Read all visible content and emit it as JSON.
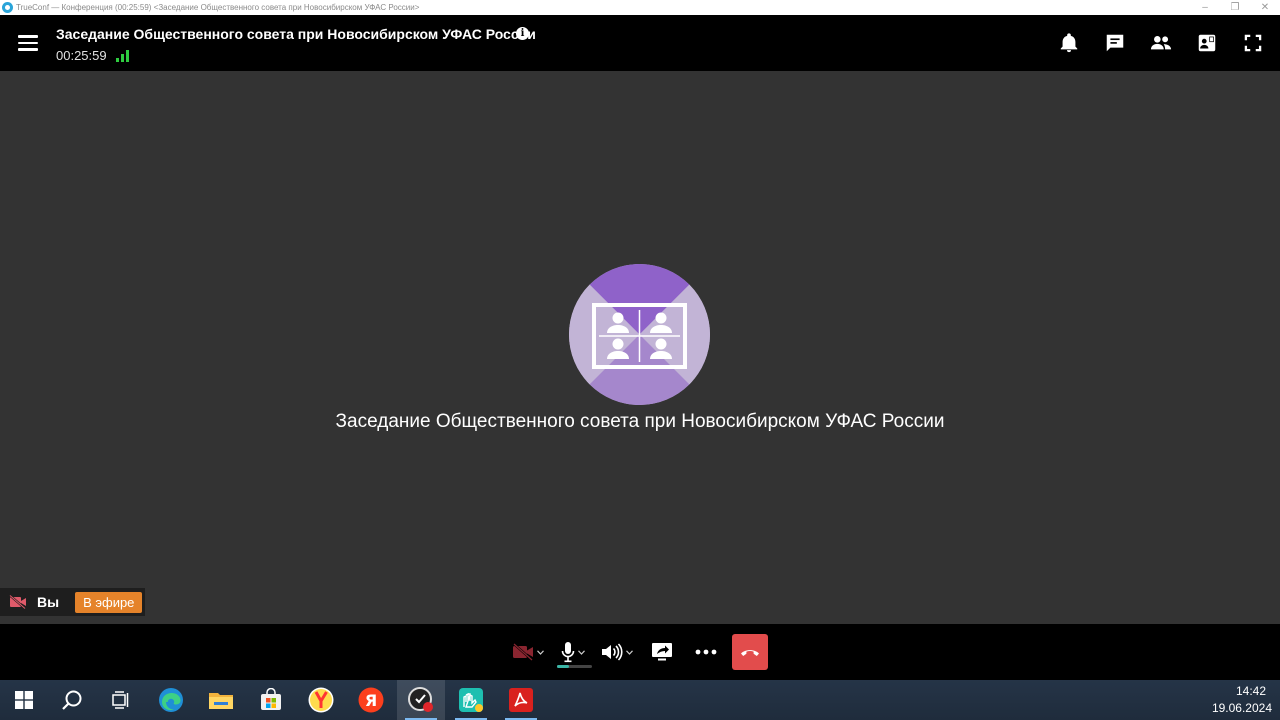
{
  "os_window": {
    "title": "TrueConf — Конференция (00:25:59) <Заседание Общественного совета при Новосибирском УФАС России>",
    "controls": [
      "–",
      "❐",
      "✕"
    ]
  },
  "header": {
    "conference_title": "Заседание Общественного совета при Новосибирском УФАС России",
    "timer": "00:25:59",
    "icons": [
      "menu-icon",
      "info-icon",
      "signal-strength-icon",
      "bell-icon",
      "chat-icon",
      "participants-icon",
      "layout-icon",
      "fullscreen-icon"
    ]
  },
  "stage": {
    "conference_name": "Заседание Общественного совета при Новосибирском УФАС России",
    "avatar_colors": {
      "top": "#8f62c9",
      "side": "#c2b4d6",
      "bottom": "#a587cc"
    }
  },
  "self_badge": {
    "label": "Вы",
    "status": "В эфире",
    "status_color": "#e5832a"
  },
  "controls": {
    "icons": [
      "camera-off-icon",
      "microphone-icon",
      "speaker-icon",
      "share-screen-icon",
      "more-icon",
      "hangup-icon"
    ],
    "mic_level": 0.35,
    "hangup_color": "#e24c4c"
  },
  "taskbar": {
    "apps": [
      "windows-start-icon",
      "search-icon",
      "task-view-icon",
      "edge-icon",
      "file-explorer-icon",
      "microsoft-store-icon",
      "yandex-browser-icon",
      "yandex-icon",
      "trueconf-icon",
      "hands-app-icon",
      "acrobat-icon"
    ],
    "time": "14:42",
    "date": "19.06.2024"
  }
}
